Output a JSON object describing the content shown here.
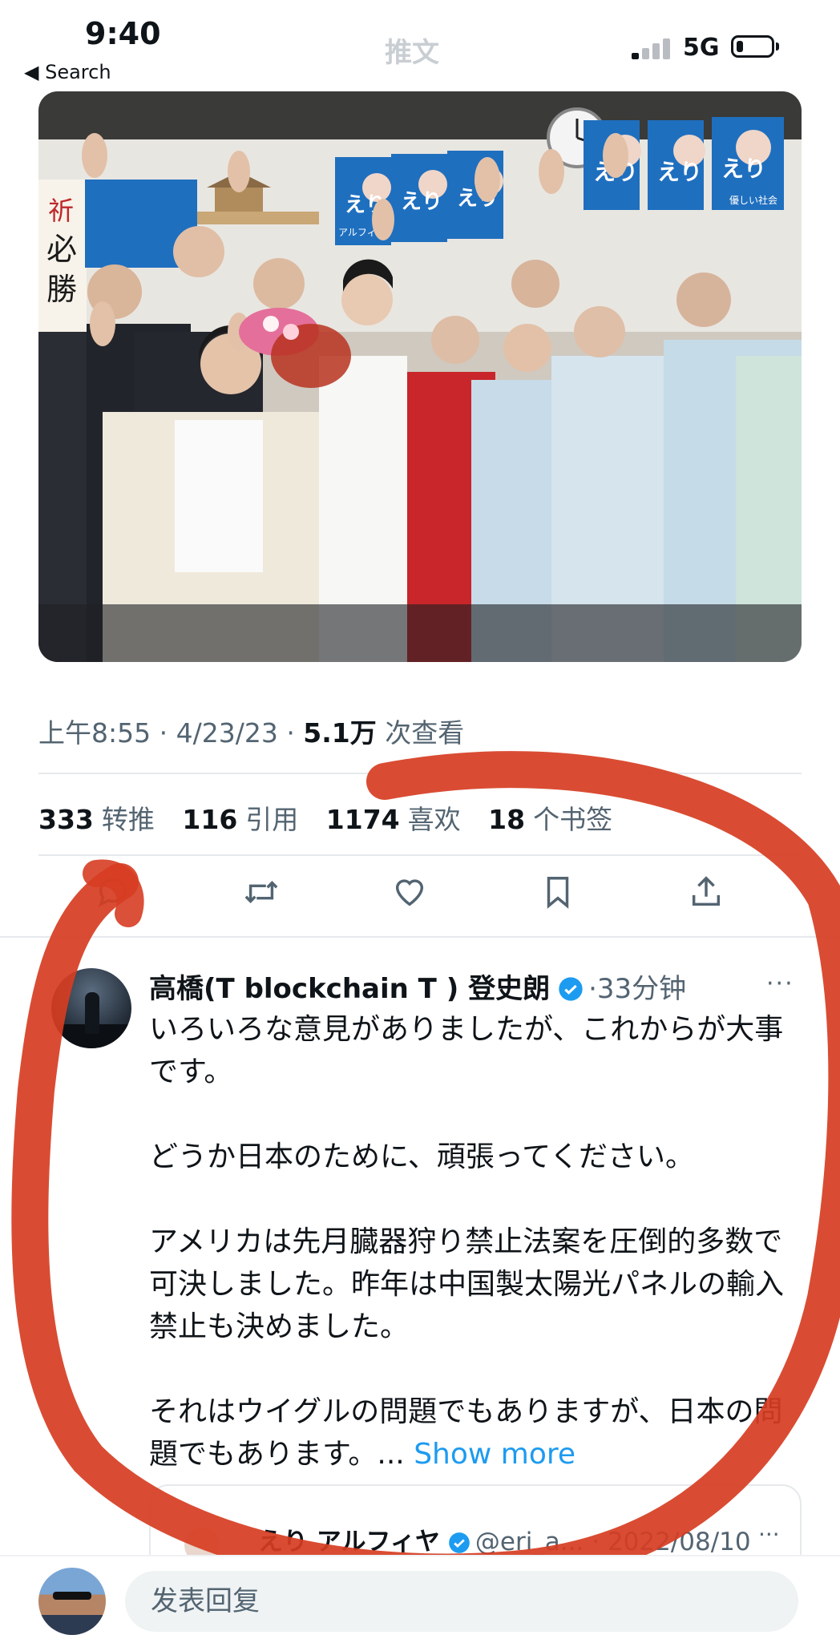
{
  "status_bar": {
    "time": "9:40",
    "back_label": "◀ Search",
    "network": "5G",
    "title": "推文"
  },
  "photo": {
    "posters": [
      "えり",
      "えり",
      "えり",
      "えり",
      "えり",
      "えり"
    ],
    "poster_caption": "アルフィヤ",
    "poster_slogan": "優しい社会",
    "banner": [
      "祈",
      "必",
      "勝"
    ]
  },
  "tweet_meta": {
    "time": "上午8:55",
    "date": "4/23/23",
    "views": "5.1万",
    "views_label": "次查看"
  },
  "stats": [
    {
      "count": "333",
      "label": "转推"
    },
    {
      "count": "116",
      "label": "引用"
    },
    {
      "count": "1174",
      "label": "喜欢"
    },
    {
      "count": "18",
      "label": "个书签"
    }
  ],
  "actions": [
    "reply-icon",
    "retweet-icon",
    "like-icon",
    "bookmark-icon",
    "share-icon"
  ],
  "reply": {
    "author": "高橋(T blockchain T ) 登史朗",
    "time": "33分钟",
    "paragraphs": [
      "いろいろな意見がありましたが、これからが大事です。",
      "どうか日本のために、頑張ってください。",
      "アメリカは先月臓器狩り禁止法案を圧倒的多数で可決しました。昨年は中国製太陽光パネルの輸入禁止も決めました。",
      "それはウイグルの問題でもありますが、日本の問題でもあります。..."
    ],
    "show_more": "Show more",
    "quote": {
      "name": "えり アルフィヤ",
      "handle": "@eri_a...",
      "date": "2022/08/10"
    }
  },
  "compose": {
    "placeholder": "发表回复"
  },
  "colors": {
    "accent": "#1d9bf0",
    "annotation": "#d63d22",
    "text": "#0f1419",
    "muted": "#536471"
  }
}
